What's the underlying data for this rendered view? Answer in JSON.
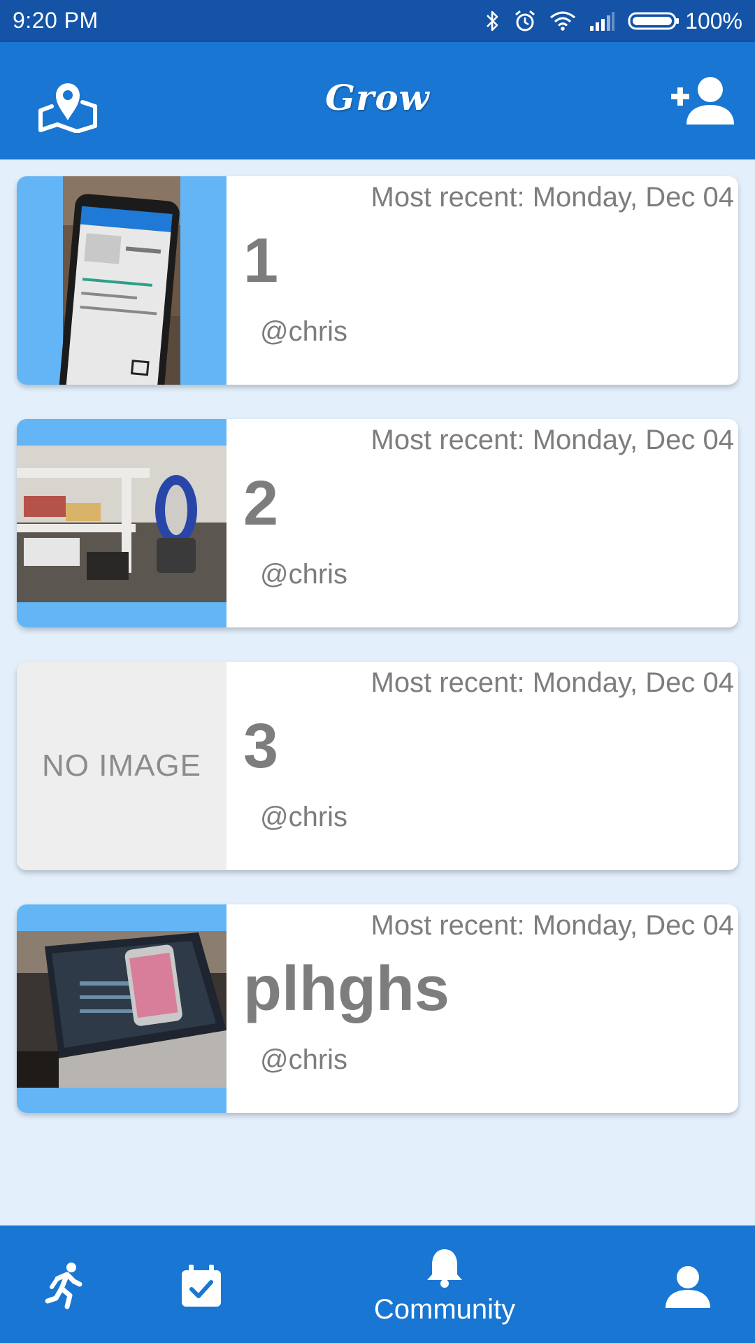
{
  "status_bar": {
    "time": "9:20 PM",
    "battery": "100%",
    "icons": [
      "bluetooth-icon",
      "alarm-icon",
      "wifi-icon",
      "signal-icon",
      "battery-icon"
    ]
  },
  "app_bar": {
    "title": "Grow",
    "left_icon": "map-pin-icon",
    "right_icon": "add-user-icon"
  },
  "cards": [
    {
      "date": "Most recent: Monday, Dec 04",
      "name": "1",
      "user": "@chris",
      "image": "photo"
    },
    {
      "date": "Most recent: Monday, Dec 04",
      "name": "2",
      "user": "@chris",
      "image": "photo"
    },
    {
      "date": "Most recent: Monday, Dec 04",
      "name": "3",
      "user": "@chris",
      "image": "none",
      "no_image_label": "NO IMAGE"
    },
    {
      "date": "Most recent: Monday, Dec 04",
      "name": "plhghs",
      "user": "@chris",
      "image": "photo"
    }
  ],
  "bottom_nav": {
    "items": [
      {
        "icon": "running-icon"
      },
      {
        "icon": "calendar-check-icon"
      },
      {
        "icon": "bell-icon",
        "label": "Community",
        "active": true
      },
      {
        "icon": "profile-icon"
      }
    ]
  },
  "colors": {
    "status_bar": "#1453A6",
    "primary": "#1976D2",
    "thumb_bg": "#64B5F6",
    "page_bg": "#E3F0FC",
    "text_gray": "#7D7D7D"
  }
}
